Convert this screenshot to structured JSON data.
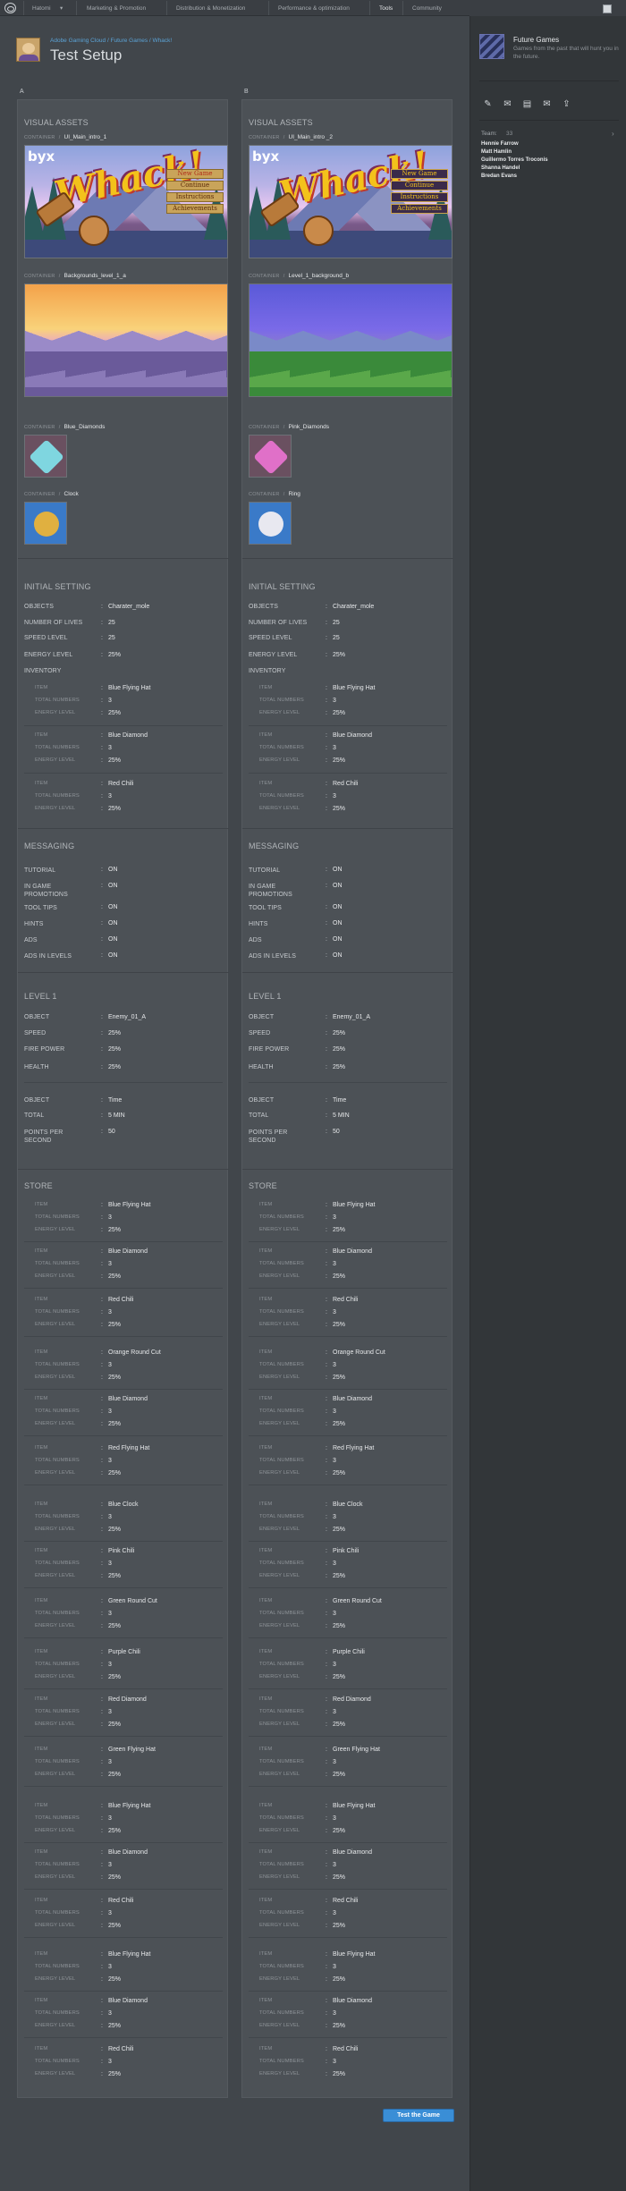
{
  "nav": {
    "items": [
      "Hatomi",
      "Marketing & Promotion",
      "Distribution & Monetization",
      "Performance & optimization",
      "Tools",
      "Community"
    ],
    "active": "Tools"
  },
  "header": {
    "breadcrumb": [
      "Adobe Gaming Cloud",
      "Future Games",
      "Whack!"
    ],
    "title": "Test Setup"
  },
  "sidebar": {
    "project_name": "Future Games",
    "project_desc": "Games from the past that will hunt you in the future.",
    "icons": [
      "pencil-icon",
      "comment-icon",
      "document-icon",
      "mail-icon",
      "share-icon"
    ],
    "team_label": "Team:",
    "team_count": "33",
    "members": [
      "Hennie Farrow",
      "Matt Hamlin",
      "Guillermo Torres Troconis",
      "Shanna Handel",
      "Bredan Evans"
    ]
  },
  "columns": {
    "a": {
      "label": "A",
      "visual_assets": {
        "title": "VISUAL ASSETS",
        "container_word": "CONTAINER",
        "ui_name": "UI_Main_intro_1",
        "bg_name": "Backgrounds_level_1_a",
        "gem_name": "Blue_Diamonds",
        "extra_name": "Clock",
        "gem_color": "#7fd6e0",
        "menu": [
          "New Game",
          "Continue",
          "Instructions",
          "Achievements"
        ]
      },
      "initial": {
        "title": "INITIAL SETTING",
        "objects": "Charater_mole",
        "number_of_lives": "25",
        "speed_level": "25",
        "energy_level": "25%",
        "inventory_label": "INVENTORY",
        "items": [
          {
            "item": "Blue Flying Hat",
            "total": "3",
            "energy": "25%"
          },
          {
            "item": "Blue Diamond",
            "total": "3",
            "energy": "25%"
          },
          {
            "item": "Red Chili",
            "total": "3",
            "energy": "25%"
          }
        ]
      },
      "messaging": {
        "title": "MESSAGING",
        "rows": [
          {
            "label": "TUTORIAL",
            "value": "ON"
          },
          {
            "label": "IN GAME PROMOTIONS",
            "value": "ON"
          },
          {
            "label": "TOOL TIPS",
            "value": "ON"
          },
          {
            "label": "HINTS",
            "value": "ON"
          },
          {
            "label": "ADS",
            "value": "ON"
          },
          {
            "label": "ADS IN LEVELS",
            "value": "ON"
          }
        ]
      },
      "level": {
        "title": "LEVEL 1",
        "object": "Enemy_01_A",
        "speed": "25%",
        "fire_power": "25%",
        "health": "25%",
        "obj2": "Time",
        "total": "5 MIN",
        "points": "50"
      },
      "store": {
        "title": "STORE",
        "items": [
          {
            "item": "Blue Flying Hat",
            "total": "3",
            "energy": "25%"
          },
          {
            "item": "Blue Diamond",
            "total": "3",
            "energy": "25%"
          },
          {
            "item": "Red Chili",
            "total": "3",
            "energy": "25%"
          },
          {
            "item": "Orange Round Cut",
            "total": "3",
            "energy": "25%"
          },
          {
            "item": "Blue Diamond",
            "total": "3",
            "energy": "25%"
          },
          {
            "item": "Red Flying Hat",
            "total": "3",
            "energy": "25%"
          },
          {
            "item": "Blue Clock",
            "total": "3",
            "energy": "25%"
          },
          {
            "item": "Pink Chili",
            "total": "3",
            "energy": "25%"
          },
          {
            "item": "Green Round Cut",
            "total": "3",
            "energy": "25%"
          },
          {
            "item": "Purple Chili",
            "total": "3",
            "energy": "25%"
          },
          {
            "item": "Red Diamond",
            "total": "3",
            "energy": "25%"
          },
          {
            "item": "Green Flying Hat",
            "total": "3",
            "energy": "25%"
          },
          {
            "item": "Blue Flying Hat",
            "total": "3",
            "energy": "25%"
          },
          {
            "item": "Blue Diamond",
            "total": "3",
            "energy": "25%"
          },
          {
            "item": "Red Chili",
            "total": "3",
            "energy": "25%"
          },
          {
            "item": "Blue Flying Hat",
            "total": "3",
            "energy": "25%"
          },
          {
            "item": "Blue Diamond",
            "total": "3",
            "energy": "25%"
          },
          {
            "item": "Red Chili",
            "total": "3",
            "energy": "25%"
          }
        ]
      }
    },
    "b": {
      "label": "B",
      "visual_assets": {
        "title": "VISUAL ASSETS",
        "container_word": "CONTAINER",
        "ui_name": "UI_Main_intro _2",
        "bg_name": "Level_1_background_b",
        "gem_name": "Pink_Diamonds",
        "extra_name": "Ring",
        "gem_color": "#e070c8",
        "menu": [
          "New Game",
          "Continue",
          "Instructions",
          "Achievements"
        ]
      },
      "initial": {
        "title": "INITIAL SETTING",
        "objects": "Charater_mole",
        "number_of_lives": "25",
        "speed_level": "25",
        "energy_level": "25%",
        "inventory_label": "INVENTORY",
        "items": [
          {
            "item": "Blue Flying Hat",
            "total": "3",
            "energy": "25%"
          },
          {
            "item": "Blue Diamond",
            "total": "3",
            "energy": "25%"
          },
          {
            "item": "Red Chili",
            "total": "3",
            "energy": "25%"
          }
        ]
      },
      "messaging": {
        "title": "MESSAGING",
        "rows": [
          {
            "label": "TUTORIAL",
            "value": "ON"
          },
          {
            "label": "IN GAME PROMOTIONS",
            "value": "ON"
          },
          {
            "label": "TOOL TIPS",
            "value": "ON"
          },
          {
            "label": "HINTS",
            "value": "ON"
          },
          {
            "label": "ADS",
            "value": "ON"
          },
          {
            "label": "ADS IN LEVELS",
            "value": "ON"
          }
        ]
      },
      "level": {
        "title": "LEVEL 1",
        "object": "Enemy_01_A",
        "speed": "25%",
        "fire_power": "25%",
        "health": "25%",
        "obj2": "Time",
        "total": "5 MIN",
        "points": "50"
      },
      "store": {
        "title": "STORE",
        "items": [
          {
            "item": "Blue Flying Hat",
            "total": "3",
            "energy": "25%"
          },
          {
            "item": "Blue Diamond",
            "total": "3",
            "energy": "25%"
          },
          {
            "item": "Red Chili",
            "total": "3",
            "energy": "25%"
          },
          {
            "item": "Orange Round Cut",
            "total": "3",
            "energy": "25%"
          },
          {
            "item": "Blue Diamond",
            "total": "3",
            "energy": "25%"
          },
          {
            "item": "Red Flying Hat",
            "total": "3",
            "energy": "25%"
          },
          {
            "item": "Blue Clock",
            "total": "3",
            "energy": "25%"
          },
          {
            "item": "Pink Chili",
            "total": "3",
            "energy": "25%"
          },
          {
            "item": "Green Round Cut",
            "total": "3",
            "energy": "25%"
          },
          {
            "item": "Purple Chili",
            "total": "3",
            "energy": "25%"
          },
          {
            "item": "Red Diamond",
            "total": "3",
            "energy": "25%"
          },
          {
            "item": "Green Flying Hat",
            "total": "3",
            "energy": "25%"
          },
          {
            "item": "Blue Flying Hat",
            "total": "3",
            "energy": "25%"
          },
          {
            "item": "Blue Diamond",
            "total": "3",
            "energy": "25%"
          },
          {
            "item": "Red Chili",
            "total": "3",
            "energy": "25%"
          },
          {
            "item": "Blue Flying Hat",
            "total": "3",
            "energy": "25%"
          },
          {
            "item": "Blue Diamond",
            "total": "3",
            "energy": "25%"
          },
          {
            "item": "Red Chili",
            "total": "3",
            "energy": "25%"
          }
        ]
      }
    }
  },
  "labels": {
    "objects": "OBJECTS",
    "number_of_lives": "NUMBER OF LIVES",
    "speed_level": "SPEED LEVEL",
    "energy_level": "ENERGY LEVEL",
    "item": "ITEM",
    "total_numbers": "TOTAL NUMBERS",
    "object": "OBJECT",
    "speed": "SPEED",
    "fire_power": "FIRE POWER",
    "health": "HEALTH",
    "total": "TOTAL",
    "points_per_second": "POINTS PER SECOND"
  },
  "test_button": "Test the Game"
}
